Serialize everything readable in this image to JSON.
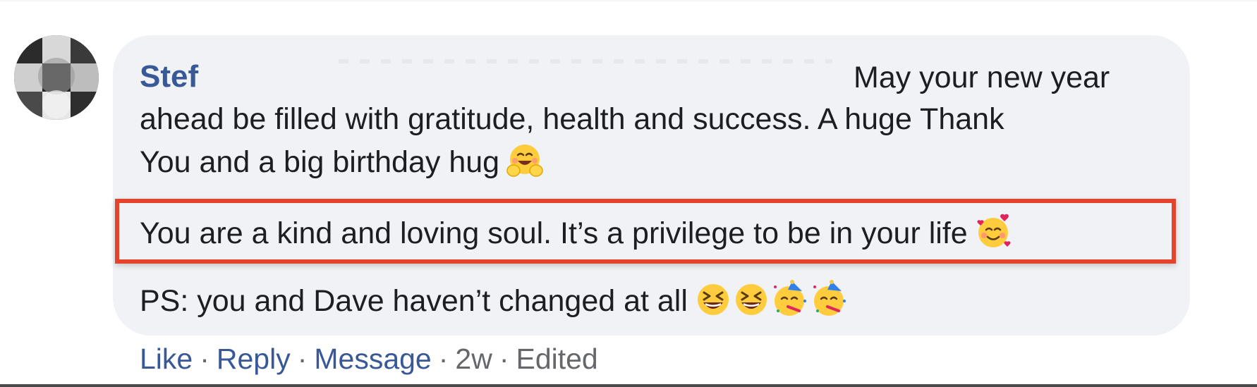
{
  "comment": {
    "author": "Stef",
    "lines": [
      "May your new year",
      "ahead be filled with gratitude, health and success. A huge Thank",
      "You and a big birthday hug",
      "You are a kind and loving soul. It’s a privilege to be in your life",
      "PS: you and Dave haven’t changed at all"
    ],
    "emojis": {
      "line3": [
        "hugging-face"
      ],
      "line4": [
        "smiling-face-with-hearts"
      ],
      "line5": [
        "grinning-squinting-face",
        "grinning-squinting-face",
        "partying-face",
        "partying-face"
      ]
    },
    "highlight_color": "#e5432b"
  },
  "actions": {
    "like": "Like",
    "reply": "Reply",
    "message": "Message",
    "time": "2w",
    "edited": "Edited",
    "separator": "·"
  },
  "colors": {
    "bubble": "#f0f2f5",
    "link": "#385898",
    "text": "#1c1e21",
    "meta": "#65676b"
  }
}
